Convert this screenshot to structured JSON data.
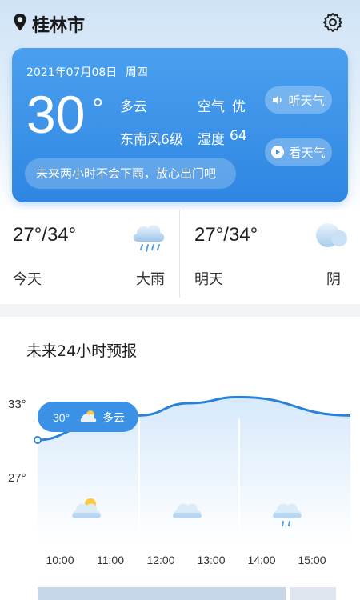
{
  "location": {
    "city": "桂林市"
  },
  "current": {
    "date": "2021年07月08日",
    "weekday": "周四",
    "temp": "30",
    "unit": "°",
    "condition": "多云",
    "wind": "东南风6级",
    "air_label": "空气",
    "air_value": "优",
    "humidity_label": "湿度",
    "humidity_value": "64",
    "listen_label": "听天气",
    "watch_label": "看天气",
    "tip": "未来两小时不会下雨，放心出门吧"
  },
  "days": [
    {
      "range": "27°/34°",
      "label": "今天",
      "condition": "大雨",
      "icon": "rain-cloud-icon"
    },
    {
      "range": "27°/34°",
      "label": "明天",
      "condition": "阴",
      "icon": "overcast-cloud-icon"
    }
  ],
  "forecast": {
    "title": "未来24小时预报",
    "tooltip": {
      "temp": "30°",
      "condition": "多云"
    }
  },
  "chart_data": {
    "type": "area",
    "x": [
      "10:00",
      "11:00",
      "12:00",
      "13:00",
      "14:00",
      "15:00"
    ],
    "series": [
      {
        "values": [
          30,
          31,
          32,
          33,
          33.5,
          32
        ]
      }
    ],
    "ytick_labels": [
      "33°",
      "27°"
    ],
    "ylim": [
      24.5,
      35
    ],
    "hour_icons": [
      "partly-cloudy-icon",
      "",
      "cloudy-icon",
      "",
      "light-rain-icon",
      ""
    ],
    "colors": {
      "line": "#2a82d8",
      "fill_top": "#d6e9fb",
      "fill_bottom": "#ffffff"
    }
  },
  "colors": {
    "card": "#3b93e8",
    "accent": "#2f86e2"
  }
}
